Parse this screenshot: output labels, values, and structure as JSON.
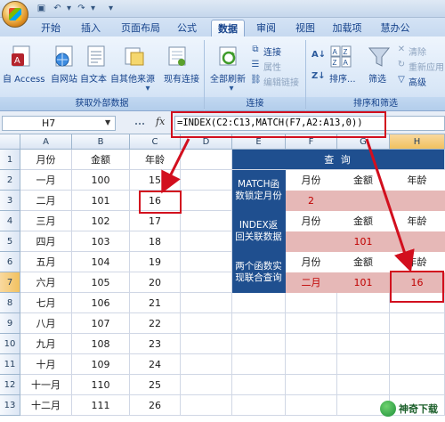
{
  "window": {
    "tabs": [
      "开始",
      "插入",
      "页面布局",
      "公式",
      "数据",
      "审阅",
      "视图",
      "加载项",
      "慧办公"
    ],
    "active_tab": "数据"
  },
  "ribbon": {
    "get_external_data": {
      "group_label": "获取外部数据",
      "access": "自 Access",
      "web": "自网站",
      "text": "自文本",
      "other": "自其他来源",
      "existing": "现有连接"
    },
    "connections": {
      "group_label": "连接",
      "refresh_all": "全部刷新",
      "connections": "连接",
      "properties": "属性",
      "edit_links": "编辑链接"
    },
    "sort_filter": {
      "group_label": "排序和筛选",
      "sort": "排序...",
      "filter": "筛选",
      "clear": "清除",
      "reapply": "重新应用",
      "advanced": "高级"
    }
  },
  "formula_bar": {
    "name_box": "H7",
    "fx": "fx",
    "formula": "=INDEX(C2:C13,MATCH(F7,A2:A13,0))"
  },
  "sheet": {
    "columns": [
      "A",
      "B",
      "C",
      "D",
      "E",
      "F",
      "G",
      "H"
    ],
    "rows": [
      "1",
      "2",
      "3",
      "4",
      "5",
      "6",
      "7",
      "8",
      "9",
      "10",
      "11",
      "12",
      "13"
    ],
    "table": {
      "header": [
        "月份",
        "金额",
        "年龄"
      ],
      "rows": [
        [
          "一月",
          "100",
          "15"
        ],
        [
          "二月",
          "101",
          "16"
        ],
        [
          "三月",
          "102",
          "17"
        ],
        [
          "四月",
          "103",
          "18"
        ],
        [
          "五月",
          "104",
          "19"
        ],
        [
          "六月",
          "105",
          "20"
        ],
        [
          "七月",
          "106",
          "21"
        ],
        [
          "八月",
          "107",
          "22"
        ],
        [
          "九月",
          "108",
          "23"
        ],
        [
          "十月",
          "109",
          "24"
        ],
        [
          "十一月",
          "110",
          "25"
        ],
        [
          "十二月",
          "111",
          "26"
        ]
      ]
    },
    "query": {
      "title": "查  询",
      "sections": [
        {
          "label": "MATCH函数锁定月份",
          "headers": [
            "月份",
            "金额",
            "年龄"
          ],
          "values": [
            "2",
            "",
            ""
          ]
        },
        {
          "label": "INDEX返回关联数据",
          "headers": [
            "月份",
            "金额",
            "年龄"
          ],
          "values": [
            "",
            "101",
            ""
          ]
        },
        {
          "label": "两个函数实现联合查询",
          "headers": [
            "月份",
            "金额",
            "年龄"
          ],
          "values": [
            "二月",
            "101",
            "16"
          ]
        }
      ]
    }
  },
  "watermark": {
    "text": "神奇下载"
  },
  "colors": {
    "query_blue": "#1f4f8f",
    "query_pink": "#e6b8b7",
    "highlight_red": "#d20f1e",
    "result_text": "#c00000"
  }
}
